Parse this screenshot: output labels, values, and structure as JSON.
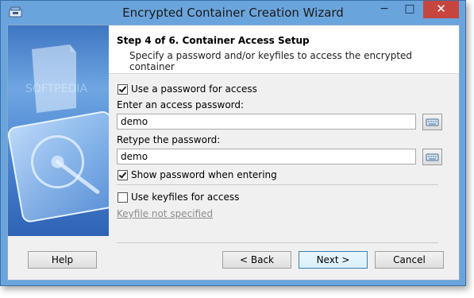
{
  "window": {
    "title": "Encrypted Container Creation Wizard",
    "controls": {
      "minimize": "−",
      "maximize": "□",
      "close": "✕"
    }
  },
  "header": {
    "step_title": "Step 4 of 6. Container Access Setup",
    "step_description": "Specify a password and/or keyfiles to access the encrypted container"
  },
  "sidebar": {
    "watermark": "SOFTPEDIA"
  },
  "password": {
    "use_password_label": "Use a password for access",
    "use_password_checked": true,
    "enter_label": "Enter an access password:",
    "enter_value": "demo",
    "retype_label": "Retype the password:",
    "retype_value": "demo",
    "show_password_label": "Show password when entering",
    "show_password_checked": true
  },
  "keyfiles": {
    "use_keyfiles_label": "Use keyfiles for access",
    "use_keyfiles_checked": false,
    "status_text": "Keyfile not specified"
  },
  "buttons": {
    "help": "Help",
    "back": "< Back",
    "next": "Next >",
    "cancel": "Cancel"
  },
  "colors": {
    "title_bar": "#6aa4dc",
    "close_button": "#c7453f",
    "dialog_background": "#f0f0f0",
    "sidebar_blue": "#3f76c2"
  }
}
